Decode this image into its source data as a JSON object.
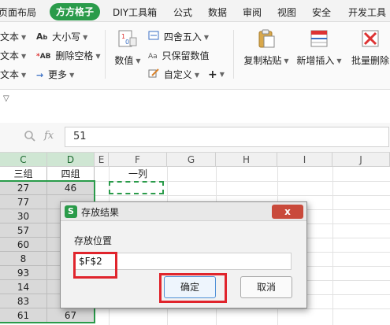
{
  "menu": {
    "tabs": [
      "页面布局",
      "方方格子",
      "DIY工具箱",
      "公式",
      "数据",
      "审阅",
      "视图",
      "安全",
      "开发工具"
    ],
    "active_index": 1
  },
  "ribbon": {
    "left_rows": [
      {
        "cut_label": "文本",
        "item_label": "大小写"
      },
      {
        "cut_label": "文本",
        "item_label": "删除空格"
      },
      {
        "cut_label": "文本",
        "item_label": "更多"
      }
    ],
    "numeric": {
      "big_label": "数值",
      "round_label": "四舍五入",
      "keep_label": "只保留数值",
      "custom_label": "自定义",
      "plus": "+"
    },
    "big_buttons": {
      "copy_paste": "复制粘贴",
      "insert": "新增插入",
      "batch_delete": "批量删除"
    }
  },
  "formula_bar": {
    "fx": "fx",
    "value": "51"
  },
  "grid": {
    "columns": [
      "C",
      "D",
      "E",
      "F",
      "G",
      "H",
      "I",
      "J"
    ],
    "header_row": {
      "c": "三组",
      "d": "四组",
      "f": "一列"
    },
    "rows": [
      {
        "c": "27",
        "d": "46"
      },
      {
        "c": "77",
        "d": ""
      },
      {
        "c": "30",
        "d": ""
      },
      {
        "c": "57",
        "d": ""
      },
      {
        "c": "60",
        "d": ""
      },
      {
        "c": "8",
        "d": ""
      },
      {
        "c": "93",
        "d": ""
      },
      {
        "c": "14",
        "d": ""
      },
      {
        "c": "83",
        "d": ""
      },
      {
        "c": "61",
        "d": "67"
      }
    ]
  },
  "dialog": {
    "logo": "S",
    "title": "存放结果",
    "close": "x",
    "label": "存放位置",
    "input_value": "$F$2",
    "ok": "确定",
    "cancel": "取消"
  },
  "colors": {
    "brand_green": "#2a9b4a",
    "highlight_red": "#e0242c",
    "close_red": "#c94a3b"
  }
}
